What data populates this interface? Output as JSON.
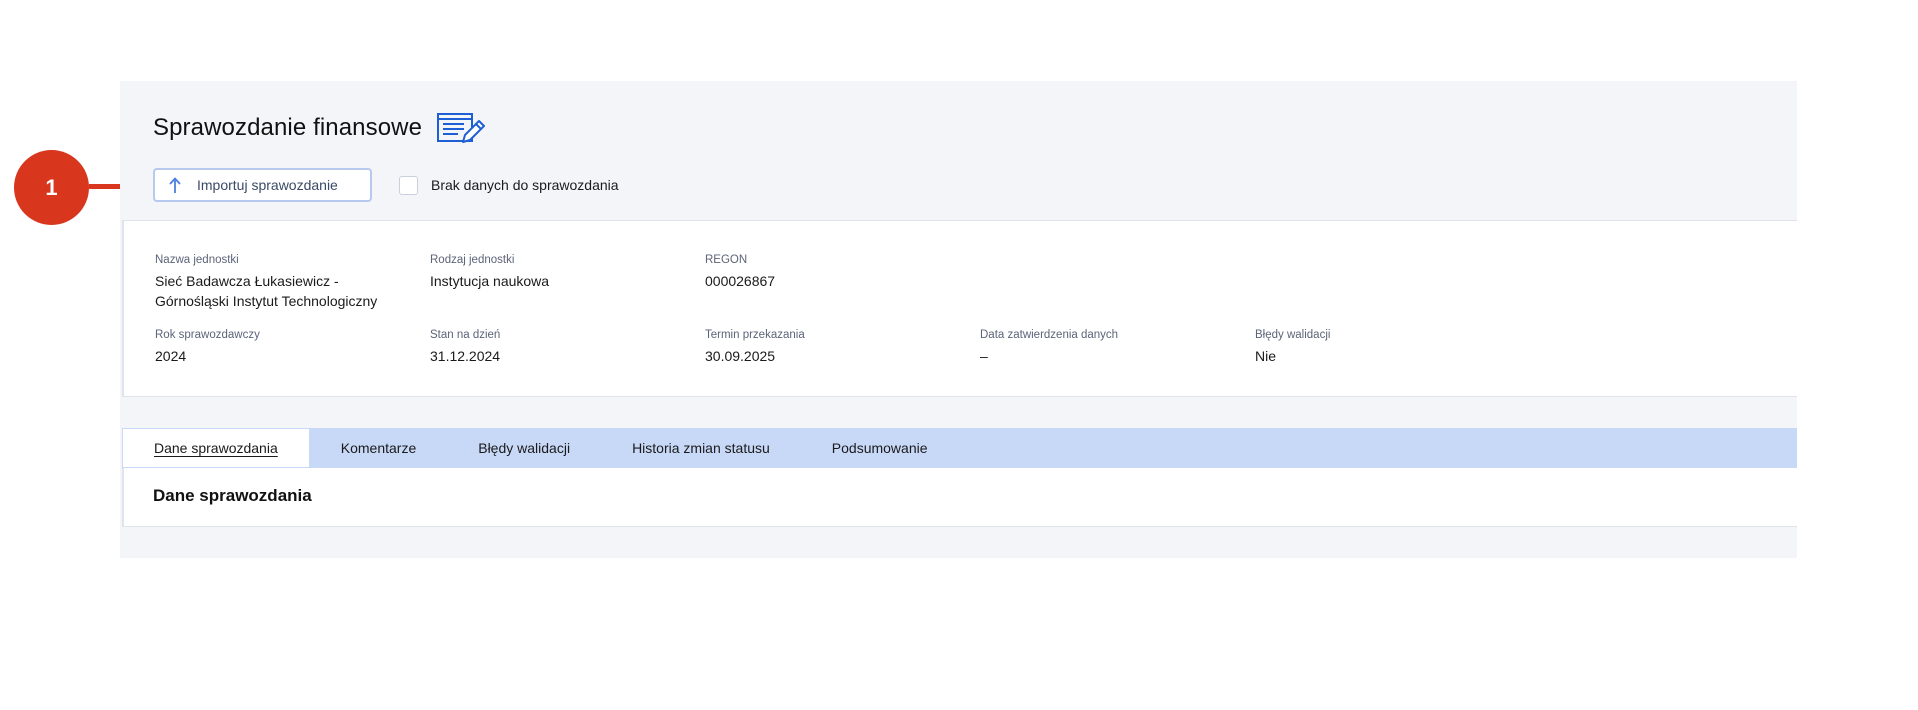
{
  "page": {
    "title": "Sprawozdanie finansowe",
    "title_icon": "document-edit-icon"
  },
  "actions": {
    "import_label": "Importuj sprawozdanie",
    "import_icon": "arrow-up-icon",
    "no_data_label": "Brak danych do sprawozdania",
    "no_data_checked": false
  },
  "info": {
    "unit_name_label": "Nazwa jednostki",
    "unit_name_line1": "Sieć Badawcza Łukasiewicz -",
    "unit_name_line2": "Górnośląski Instytut Technologiczny",
    "unit_type_label": "Rodzaj jednostki",
    "unit_type_value": "Instytucja naukowa",
    "regon_label": "REGON",
    "regon_value": "000026867",
    "year_label": "Rok sprawozdawczy",
    "year_value": "2024",
    "as_of_label": "Stan na dzień",
    "as_of_value": "31.12.2024",
    "deadline_label": "Termin przekazania",
    "deadline_value": "30.09.2025",
    "approval_label": "Data zatwierdzenia danych",
    "approval_value": "–",
    "errors_label": "Błędy walidacji",
    "errors_value": "Nie"
  },
  "tabs": [
    {
      "label": "Dane sprawozdania",
      "active": true
    },
    {
      "label": "Komentarze",
      "active": false
    },
    {
      "label": "Błędy walidacji",
      "active": false
    },
    {
      "label": "Historia zmian statusu",
      "active": false
    },
    {
      "label": "Podsumowanie",
      "active": false
    }
  ],
  "tab_panel": {
    "title": "Dane sprawozdania"
  },
  "annotation": {
    "number": "1"
  },
  "colors": {
    "accent_blue": "#1f5fd6",
    "tab_bar": "#c8d9f8",
    "callout_red": "#d9361e",
    "panel_bg": "#f4f5f9"
  }
}
